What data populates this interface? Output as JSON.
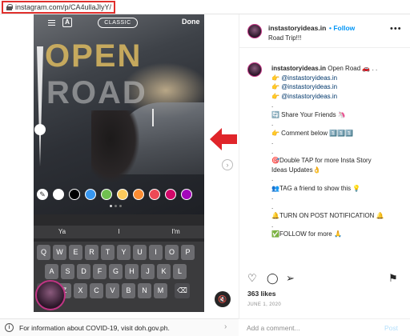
{
  "browser": {
    "url": "instagram.com/p/CA4ullaJlyY/"
  },
  "story": {
    "top": {
      "aa_label": "A",
      "style_label": "CLASSIC",
      "done_label": "Done"
    },
    "headline": [
      "OPEN",
      "ROAD"
    ],
    "color_swatches": [
      "#ffffff",
      "#000000",
      "#3897f0",
      "#70c050",
      "#fdcb5c",
      "#fd8d32",
      "#ed4956",
      "#d10869",
      "#a307ba"
    ],
    "suggestions": [
      "Ya",
      "I",
      "I'm"
    ],
    "keyboard": {
      "row1": [
        "Q",
        "W",
        "E",
        "R",
        "T",
        "Y",
        "U",
        "I",
        "O",
        "P"
      ],
      "row2": [
        "A",
        "S",
        "D",
        "F",
        "G",
        "H",
        "J",
        "K",
        "L"
      ],
      "row3": [
        "Z",
        "X",
        "C",
        "V",
        "B",
        "N",
        "M"
      ]
    }
  },
  "post": {
    "username": "instastoryideas.in",
    "follow_label": "Follow",
    "location": "Road Trip!!!",
    "caption": {
      "line1_user": "instastoryideas.in",
      "line1_text": "Open Road 🚗 . .",
      "mentions": [
        "@instastoryideas.in",
        "@instastoryideas.in",
        "@instastoryideas.in"
      ],
      "body": [
        ".",
        "🔄 Share Your Friends 🦄",
        ".",
        "👉 Comment below 1️⃣1️⃣1️⃣",
        ".",
        ".",
        "🎯Double TAP for more Insta Story",
        "Ideas Updates👌",
        ".",
        "👥TAG a friend to show this 💡",
        ".",
        ".",
        "🔔TURN ON POST NOTIFICATION 🔔",
        ".",
        "✅FOLLOW for more 🙏"
      ]
    },
    "likes": "363 likes",
    "date": "JUNE 1, 2020",
    "comment_placeholder": "Add a comment...",
    "post_label": "Post"
  },
  "banner": {
    "text": "For information about COVID-19, visit doh.gov.ph."
  }
}
